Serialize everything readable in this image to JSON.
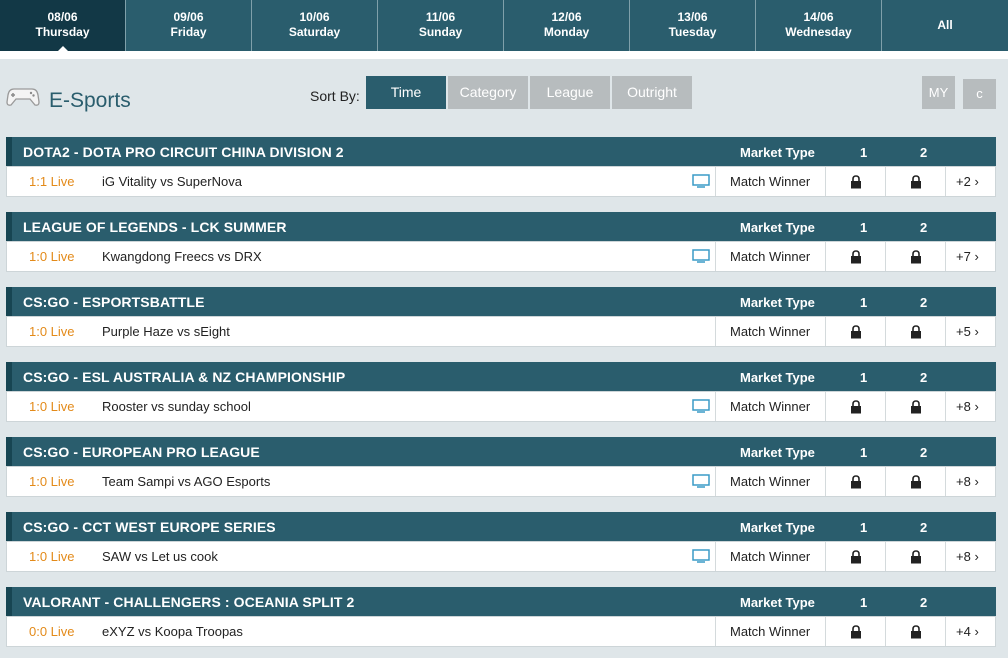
{
  "dates": [
    {
      "date": "08/06",
      "day": "Thursday",
      "active": true
    },
    {
      "date": "09/06",
      "day": "Friday"
    },
    {
      "date": "10/06",
      "day": "Saturday"
    },
    {
      "date": "11/06",
      "day": "Sunday"
    },
    {
      "date": "12/06",
      "day": "Monday"
    },
    {
      "date": "13/06",
      "day": "Tuesday"
    },
    {
      "date": "14/06",
      "day": "Wednesday"
    }
  ],
  "all_label": "All",
  "sport": {
    "title": "E-Sports",
    "icon": "gamepad-icon"
  },
  "sort": {
    "label": "Sort By:",
    "options": [
      "Time",
      "Category",
      "League",
      "Outright"
    ],
    "active": "Time"
  },
  "my_label": "MY",
  "refresh_label": "c",
  "columns": {
    "market_type": "Market Type",
    "col1": "1",
    "col2": "2"
  },
  "leagues": [
    {
      "name": "DOTA2 - DOTA PRO CIRCUIT CHINA DIVISION 2",
      "score": "1:1 Live",
      "match": "iG Vitality vs SuperNova",
      "tv": true,
      "market": "Match Winner",
      "more": "+2"
    },
    {
      "name": "LEAGUE OF LEGENDS - LCK SUMMER",
      "score": "1:0 Live",
      "match": "Kwangdong Freecs vs DRX",
      "tv": true,
      "market": "Match Winner",
      "more": "+7"
    },
    {
      "name": "CS:GO - ESPORTSBATTLE",
      "score": "1:0 Live",
      "match": "Purple Haze vs sEight",
      "tv": false,
      "market": "Match Winner",
      "more": "+5"
    },
    {
      "name": "CS:GO - ESL AUSTRALIA & NZ CHAMPIONSHIP",
      "score": "1:0 Live",
      "match": "Rooster vs sunday school",
      "tv": true,
      "market": "Match Winner",
      "more": "+8"
    },
    {
      "name": "CS:GO - EUROPEAN PRO LEAGUE",
      "score": "1:0 Live",
      "match": "Team Sampi vs AGO Esports",
      "tv": true,
      "market": "Match Winner",
      "more": "+8"
    },
    {
      "name": "CS:GO - CCT WEST EUROPE SERIES",
      "score": "1:0 Live",
      "match": "SAW vs Let us cook",
      "tv": true,
      "market": "Match Winner",
      "more": "+8"
    },
    {
      "name": "VALORANT - CHALLENGERS : OCEANIA SPLIT 2",
      "score": "0:0 Live",
      "match": "eXYZ vs Koopa Troopas",
      "tv": false,
      "market": "Match Winner",
      "more": "+4"
    }
  ],
  "colors": {
    "header_bg": "#2a5d6d",
    "active_tab": "#123846",
    "live": "#e38a19",
    "inactive_btn": "#b7bcbe",
    "tv_icon": "#3a9bc7"
  }
}
